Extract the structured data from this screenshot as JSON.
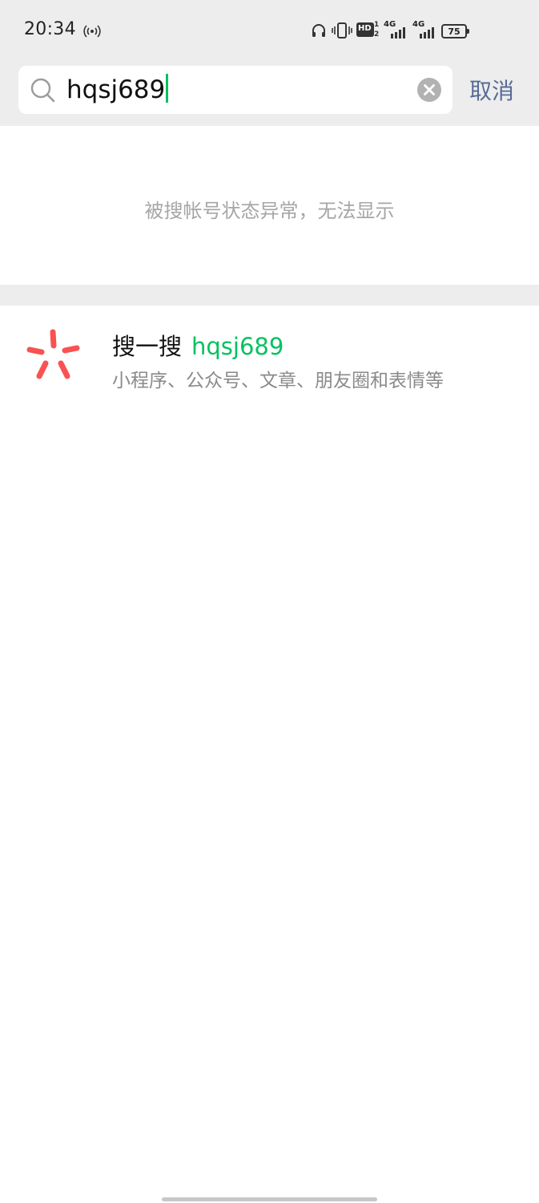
{
  "status_bar": {
    "time": "20:34",
    "network_1": "4G",
    "network_2": "4G",
    "hd_label": "HD",
    "battery": "75"
  },
  "search": {
    "value": "hqsj689",
    "cancel_label": "取消"
  },
  "notice": {
    "text": "被搜帐号状态异常，无法显示"
  },
  "souyisou": {
    "title": "搜一搜",
    "keyword": "hqsj689",
    "description": "小程序、公众号、文章、朋友圈和表情等",
    "icon": "souyisou-star-icon",
    "icon_color": "#fa5151"
  },
  "colors": {
    "accent_green": "#07c160",
    "link_blue": "#576b95",
    "header_bg": "#ededed"
  }
}
